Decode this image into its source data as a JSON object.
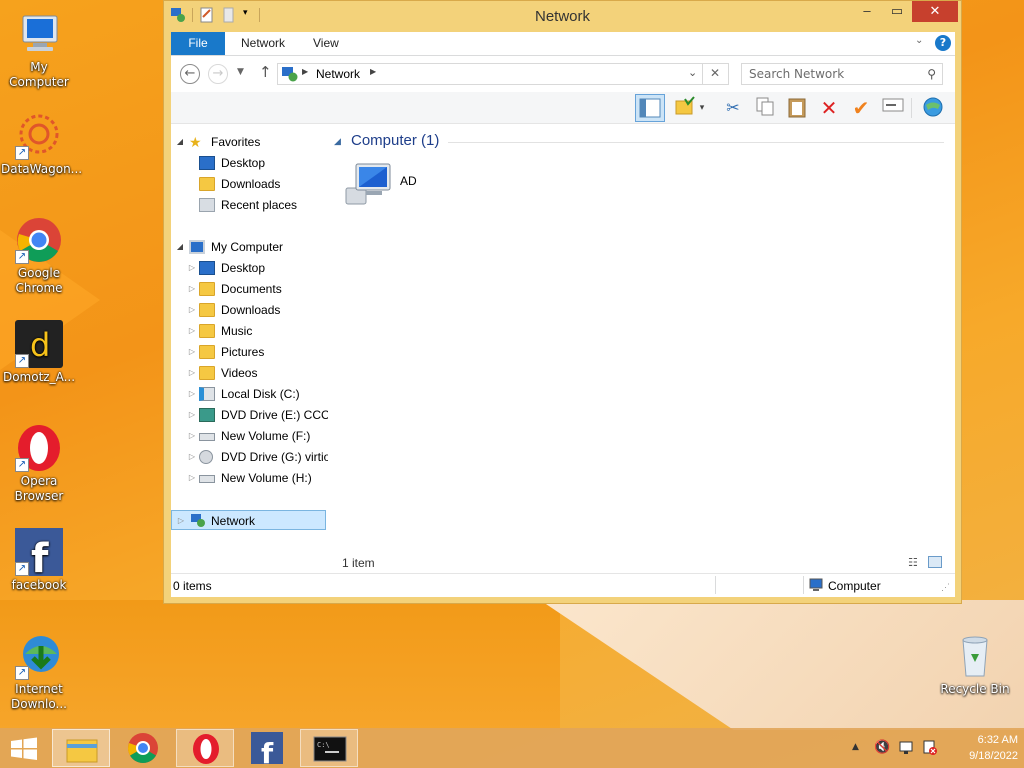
{
  "desktop": {
    "icons": [
      {
        "name": "my-computer",
        "label": "My Computer"
      },
      {
        "name": "datawagon",
        "label": "DataWagon..."
      },
      {
        "name": "google-chrome",
        "label": "Google Chrome"
      },
      {
        "name": "domotz",
        "label": "Domotz_A..."
      },
      {
        "name": "opera-browser",
        "label": "Opera Browser"
      },
      {
        "name": "facebook",
        "label": "facebook"
      },
      {
        "name": "internet-download",
        "label": "Internet Downlo..."
      },
      {
        "name": "recycle-bin",
        "label": "Recycle Bin"
      }
    ]
  },
  "window": {
    "title": "Network",
    "tabs": [
      "File",
      "Network",
      "View"
    ],
    "address": {
      "path": "Network"
    },
    "search_placeholder": "Search Network",
    "nav": {
      "favorites": {
        "label": "Favorites",
        "items": [
          "Desktop",
          "Downloads",
          "Recent places"
        ]
      },
      "computer": {
        "label": "My Computer",
        "items": [
          "Desktop",
          "Documents",
          "Downloads",
          "Music",
          "Pictures",
          "Videos",
          "Local Disk (C:)",
          "DVD Drive (E:) CCCC",
          "New Volume (F:)",
          "DVD Drive (G:) virtio",
          "New Volume (H:)"
        ]
      },
      "network": {
        "label": "Network"
      }
    },
    "group": {
      "header": "Computer (1)",
      "items": [
        {
          "label": "AD"
        }
      ]
    },
    "item_count": "1 item",
    "status": {
      "left": "0 items",
      "right": "Computer"
    }
  },
  "taskbar": {
    "time": "6:32 AM",
    "date": "9/18/2022"
  },
  "colors": {
    "accent": "#1979ca",
    "close": "#c7402d",
    "window_frame": "#f3d27a",
    "selection": "#cce8ff"
  }
}
